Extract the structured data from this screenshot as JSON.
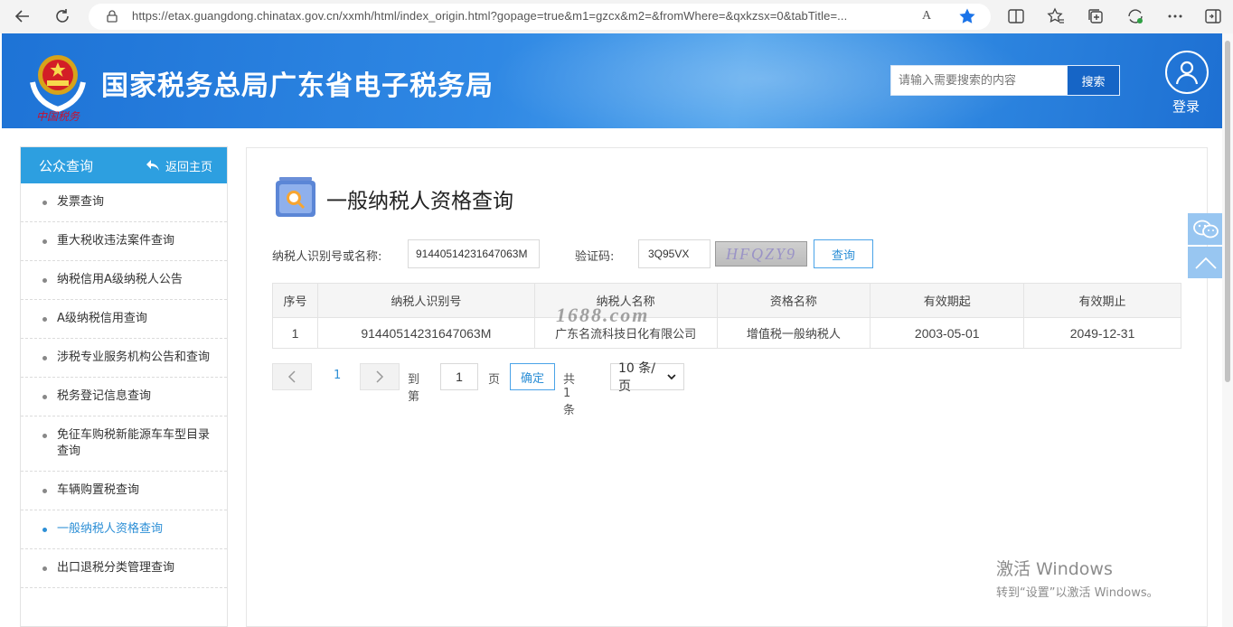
{
  "browser": {
    "url": "https://etax.guangdong.chinatax.gov.cn/xxmh/html/index_origin.html?gopage=true&m1=gzcx&m2=&fromWhere=&qxkzsx=0&tabTitle=...",
    "read_aloud": "A"
  },
  "header": {
    "site_title": "国家税务总局广东省电子税务局",
    "search_placeholder": "请输入需要搜索的内容",
    "search_button": "搜索",
    "login_label": "登录",
    "emblem_caption": "中国税务"
  },
  "sidebar": {
    "title": "公众查询",
    "back_home": "返回主页",
    "items": [
      {
        "label": "发票查询"
      },
      {
        "label": "重大税收违法案件查询"
      },
      {
        "label": "纳税信用A级纳税人公告"
      },
      {
        "label": "A级纳税信用查询"
      },
      {
        "label": "涉税专业服务机构公告和查询"
      },
      {
        "label": "税务登记信息查询"
      },
      {
        "label": "免征车购税新能源车车型目录查询"
      },
      {
        "label": "车辆购置税查询"
      },
      {
        "label": "一般纳税人资格查询"
      },
      {
        "label": "出口退税分类管理查询"
      }
    ],
    "active_index": 8
  },
  "main": {
    "page_title": "一般纳税人资格查询",
    "taxid_label": "纳税人识别号或名称:",
    "taxid_value": "91440514231647063M",
    "captcha_label": "验证码:",
    "captcha_value": "3Q95VX",
    "captcha_image_text": "HFQZY9",
    "query_button": "查询",
    "table": {
      "headers": [
        "序号",
        "纳税人识别号",
        "纳税人名称",
        "资格名称",
        "有效期起",
        "有效期止"
      ],
      "rows": [
        [
          "1",
          "91440514231647063M",
          "广东名流科技日化有限公司",
          "增值税一般纳税人",
          "2003-05-01",
          "2049-12-31"
        ]
      ]
    },
    "watermark": "1688.com",
    "pager": {
      "current_page": "1",
      "goto_label": "到第",
      "goto_value": "1",
      "page_unit": "页",
      "confirm": "确定",
      "total": "共 1 条",
      "page_size": "10 条/页"
    }
  },
  "os_watermark": {
    "line1": "激活 Windows",
    "line2": "转到“设置”以激活 Windows。"
  },
  "colors": {
    "accent": "#2d9fe0",
    "banner": "#2f88e4",
    "link_active": "#2d8fd6"
  }
}
